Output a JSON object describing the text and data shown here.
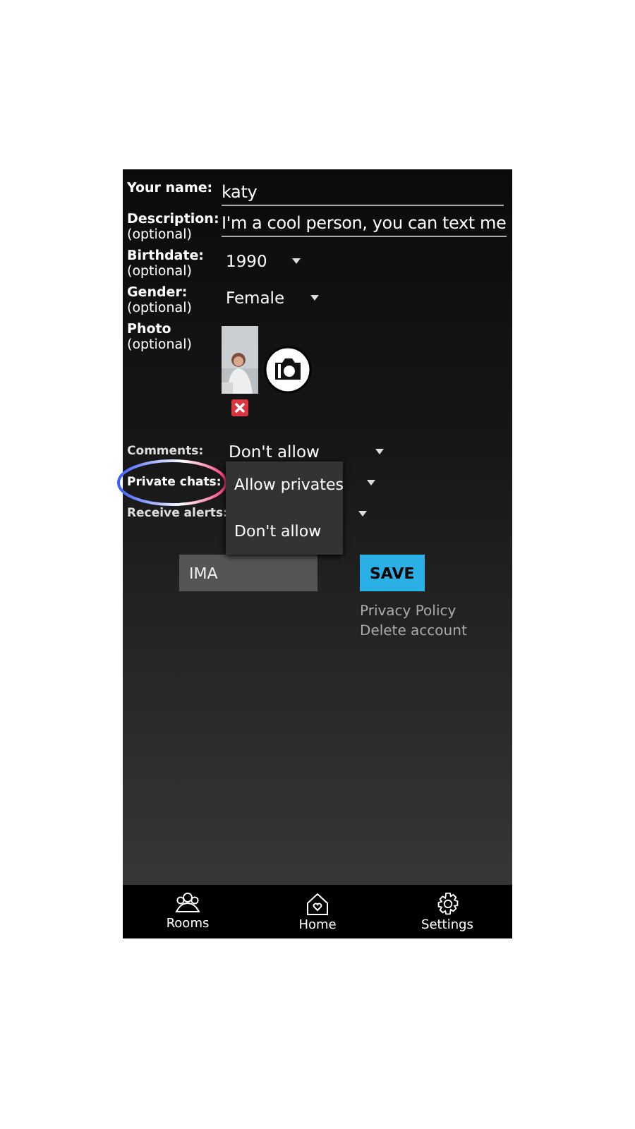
{
  "fields": [
    {
      "kind": "text",
      "label": "Your name:",
      "value": "katy"
    },
    {
      "kind": "text",
      "label": "Description:",
      "hint": "(optional)",
      "value": "I'm a cool person, you can text me"
    },
    {
      "kind": "select",
      "label": "Birthdate:",
      "hint": "(optional)",
      "value": "1990"
    },
    {
      "kind": "select",
      "label": "Gender:",
      "hint": "(optional)",
      "value": "Female"
    },
    {
      "label": "Photo",
      "hint": "(optional)"
    }
  ],
  "settings": [
    {
      "label": "Comments:",
      "value": "Don't allow"
    },
    {
      "label": "Private chats:",
      "highlighted": true
    },
    {
      "label": "Receive alerts:"
    }
  ],
  "dropdown": {
    "options": [
      "Allow privates",
      "Don't allow"
    ]
  },
  "image_button": "IMA",
  "save_button": "SAVE",
  "links": [
    "Privacy Policy",
    "Delete account"
  ],
  "nav": [
    {
      "label": "Rooms"
    },
    {
      "label": "Home"
    },
    {
      "label": "Settings"
    }
  ]
}
